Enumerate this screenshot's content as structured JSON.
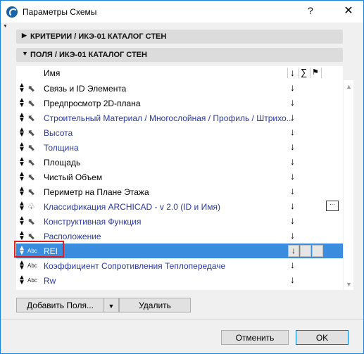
{
  "window": {
    "title": "Параметры Схемы",
    "help_symbol": "?",
    "close_symbol": "✕"
  },
  "sections": {
    "criteria": "КРИТЕРИИ / ИКЭ-01 КАТАЛОГ СТЕН",
    "fields": "ПОЛЯ / ИКЭ-01 КАТАЛОГ СТЕН"
  },
  "columns": {
    "name": "Имя",
    "sort_symbol": "↓",
    "sum_symbol": "∑",
    "flag_symbol": "⚑"
  },
  "rows": [
    {
      "name": "Связь и ID Элемента",
      "icon": "pointer-icon",
      "linked": false
    },
    {
      "name": "Предпросмотр 2D-плана",
      "icon": "pointer-icon",
      "linked": false
    },
    {
      "name": "Строительный Материал / Многослойная / Профиль / Штрихо...",
      "icon": "pointer-icon",
      "linked": true
    },
    {
      "name": "Высота",
      "icon": "pointer-icon",
      "linked": true
    },
    {
      "name": "Толщина",
      "icon": "pointer-icon",
      "linked": true
    },
    {
      "name": "Площадь",
      "icon": "pointer-icon",
      "linked": false
    },
    {
      "name": "Чистый Объем",
      "icon": "pointer-icon",
      "linked": false
    },
    {
      "name": "Периметр на Плане Этажа",
      "icon": "pointer-icon",
      "linked": false
    },
    {
      "name": "Классификация ARCHICAD - v 2.0 (ID и Имя)",
      "icon": "classification-tree-icon",
      "linked": true
    },
    {
      "name": "Конструктивная Функция",
      "icon": "pointer-icon",
      "linked": true
    },
    {
      "name": "Расположение",
      "icon": "pointer-icon",
      "linked": true
    },
    {
      "name": "REI",
      "icon": "text-property-icon",
      "linked": false,
      "selected": true
    },
    {
      "name": "Коэффициент Сопротивления Теплопередаче",
      "icon": "text-property-icon",
      "linked": true
    },
    {
      "name": "Rw",
      "icon": "text-property-icon",
      "linked": true
    }
  ],
  "type_labels": {
    "abc": "Abc"
  },
  "buttons": {
    "add_fields": "Добавить Поля...",
    "delete": "Удалить",
    "cancel": "Отменить",
    "ok": "OK"
  },
  "colors": {
    "selection": "#3a8dde",
    "link_text": "#2b3a9a",
    "highlight_border": "#e02020"
  }
}
